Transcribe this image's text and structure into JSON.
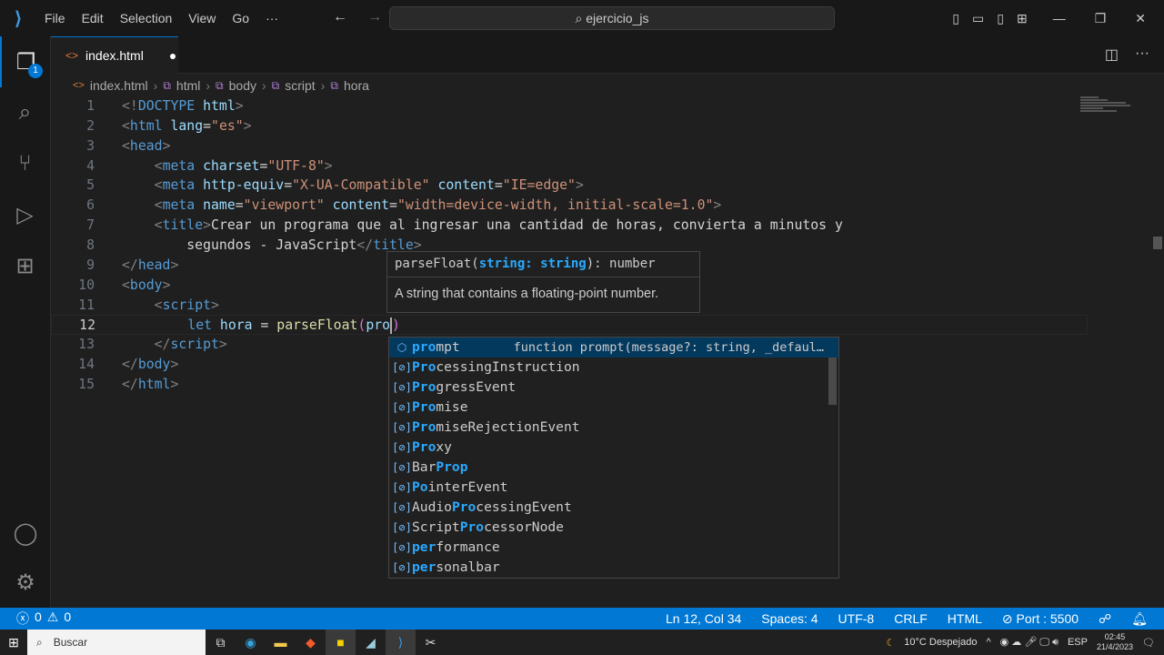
{
  "titlebar": {
    "menu": [
      "File",
      "Edit",
      "Selection",
      "View",
      "Go",
      "···"
    ],
    "search": "ejercicio_js"
  },
  "activity": {
    "explorer_badge": "1"
  },
  "tab": {
    "label": "index.html",
    "modified": "●"
  },
  "breadcrumb": [
    "index.html",
    "html",
    "body",
    "script",
    "hora"
  ],
  "code": [
    {
      "n": "1",
      "t": [
        [
          "t-br",
          "<!"
        ],
        [
          "t-tag",
          "DOCTYPE"
        ],
        [
          "t-attr",
          " html"
        ],
        [
          "t-br",
          ">"
        ]
      ]
    },
    {
      "n": "2",
      "t": [
        [
          "t-br",
          "<"
        ],
        [
          "t-tag",
          "html"
        ],
        [
          "t-attr",
          " lang"
        ],
        [
          "t-txt",
          "="
        ],
        [
          "t-str",
          "\"es\""
        ],
        [
          "t-br",
          ">"
        ]
      ]
    },
    {
      "n": "3",
      "t": [
        [
          "t-br",
          "<"
        ],
        [
          "t-tag",
          "head"
        ],
        [
          "t-br",
          ">"
        ]
      ]
    },
    {
      "n": "4",
      "t": [
        [
          "t-txt",
          "    "
        ],
        [
          "t-br",
          "<"
        ],
        [
          "t-tag",
          "meta"
        ],
        [
          "t-attr",
          " charset"
        ],
        [
          "t-txt",
          "="
        ],
        [
          "t-str",
          "\"UTF-8\""
        ],
        [
          "t-br",
          ">"
        ]
      ]
    },
    {
      "n": "5",
      "t": [
        [
          "t-txt",
          "    "
        ],
        [
          "t-br",
          "<"
        ],
        [
          "t-tag",
          "meta"
        ],
        [
          "t-attr",
          " http-equiv"
        ],
        [
          "t-txt",
          "="
        ],
        [
          "t-str",
          "\"X-UA-Compatible\""
        ],
        [
          "t-attr",
          " content"
        ],
        [
          "t-txt",
          "="
        ],
        [
          "t-str",
          "\"IE=edge\""
        ],
        [
          "t-br",
          ">"
        ]
      ]
    },
    {
      "n": "6",
      "t": [
        [
          "t-txt",
          "    "
        ],
        [
          "t-br",
          "<"
        ],
        [
          "t-tag",
          "meta"
        ],
        [
          "t-attr",
          " name"
        ],
        [
          "t-txt",
          "="
        ],
        [
          "t-str",
          "\"viewport\""
        ],
        [
          "t-attr",
          " content"
        ],
        [
          "t-txt",
          "="
        ],
        [
          "t-str",
          "\"width=device-width, initial-scale=1.0\""
        ],
        [
          "t-br",
          ">"
        ]
      ]
    },
    {
      "n": "7",
      "t": [
        [
          "t-txt",
          "    "
        ],
        [
          "t-br",
          "<"
        ],
        [
          "t-tag",
          "title"
        ],
        [
          "t-br",
          ">"
        ],
        [
          "t-txt",
          "Crear un programa que al ingresar una cantidad de horas, convierta a minutos y"
        ]
      ]
    },
    {
      "n": "8",
      "t": [
        [
          "t-txt",
          "        segundos - JavaScript"
        ],
        [
          "t-br",
          "</"
        ],
        [
          "t-tag",
          "title"
        ],
        [
          "t-br",
          ">"
        ]
      ]
    },
    {
      "n": "9",
      "t": [
        [
          "t-br",
          "</"
        ],
        [
          "t-tag",
          "head"
        ],
        [
          "t-br",
          ">"
        ]
      ]
    },
    {
      "n": "10",
      "t": [
        [
          "t-br",
          "<"
        ],
        [
          "t-tag",
          "body"
        ],
        [
          "t-br",
          ">"
        ]
      ]
    },
    {
      "n": "11",
      "t": [
        [
          "t-txt",
          "    "
        ],
        [
          "t-br",
          "<"
        ],
        [
          "t-tag",
          "script"
        ],
        [
          "t-br",
          ">"
        ]
      ]
    },
    {
      "n": "12",
      "t": [
        [
          "t-txt",
          "        "
        ],
        [
          "t-kw",
          "let"
        ],
        [
          "t-var",
          " hora"
        ],
        [
          "t-txt",
          " = "
        ],
        [
          "t-fn",
          "parseFloat"
        ],
        [
          "t-p",
          "("
        ],
        [
          "t-var",
          "pro"
        ],
        [
          "t-p",
          ")"
        ]
      ]
    },
    {
      "n": "13",
      "t": [
        [
          "t-txt",
          "    "
        ],
        [
          "t-br",
          "</"
        ],
        [
          "t-tag",
          "script"
        ],
        [
          "t-br",
          ">"
        ]
      ]
    },
    {
      "n": "14",
      "t": [
        [
          "t-br",
          "</"
        ],
        [
          "t-tag",
          "body"
        ],
        [
          "t-br",
          ">"
        ]
      ]
    },
    {
      "n": "15",
      "t": [
        [
          "t-br",
          "</"
        ],
        [
          "t-tag",
          "html"
        ],
        [
          "t-br",
          ">"
        ]
      ]
    }
  ],
  "hover": {
    "sig_name": "parseFloat(",
    "sig_param": "string: string",
    "sig_rest": "): number",
    "doc": "A string that contains a floating-point number."
  },
  "suggest": [
    {
      "kind": "method",
      "m": "pro",
      "r": "mpt",
      "detail": "function prompt(message?: string, _defaul…"
    },
    {
      "kind": "var",
      "m": "Pro",
      "r": "cessingInstruction"
    },
    {
      "kind": "var",
      "m": "Pro",
      "r": "gressEvent"
    },
    {
      "kind": "var",
      "m": "Pro",
      "r": "mise"
    },
    {
      "kind": "var",
      "m": "Pro",
      "r": "miseRejectionEvent"
    },
    {
      "kind": "var",
      "m": "Pro",
      "r": "xy"
    },
    {
      "kind": "var",
      "p": "Bar",
      "m": "Prop",
      "r": ""
    },
    {
      "kind": "var",
      "m": "Po",
      "r": "interEvent"
    },
    {
      "kind": "var",
      "p": "Audio",
      "m": "Pro",
      "r": "cessingEvent"
    },
    {
      "kind": "var",
      "p": "Script",
      "m": "Pro",
      "r": "cessorNode"
    },
    {
      "kind": "var",
      "m": "per",
      "r": "formance"
    },
    {
      "kind": "var",
      "m": "per",
      "r": "sonalbar"
    }
  ],
  "status": {
    "errors": "0",
    "warnings": "0",
    "position": "Ln 12, Col 34",
    "spaces": "Spaces: 4",
    "encoding": "UTF-8",
    "eol": "CRLF",
    "language": "HTML",
    "port": "Port : 5500"
  },
  "taskbar": {
    "search": "Buscar",
    "weather": "10°C  Despejado",
    "lang": "ESP",
    "time": "02:45",
    "date": "21/4/2023"
  }
}
